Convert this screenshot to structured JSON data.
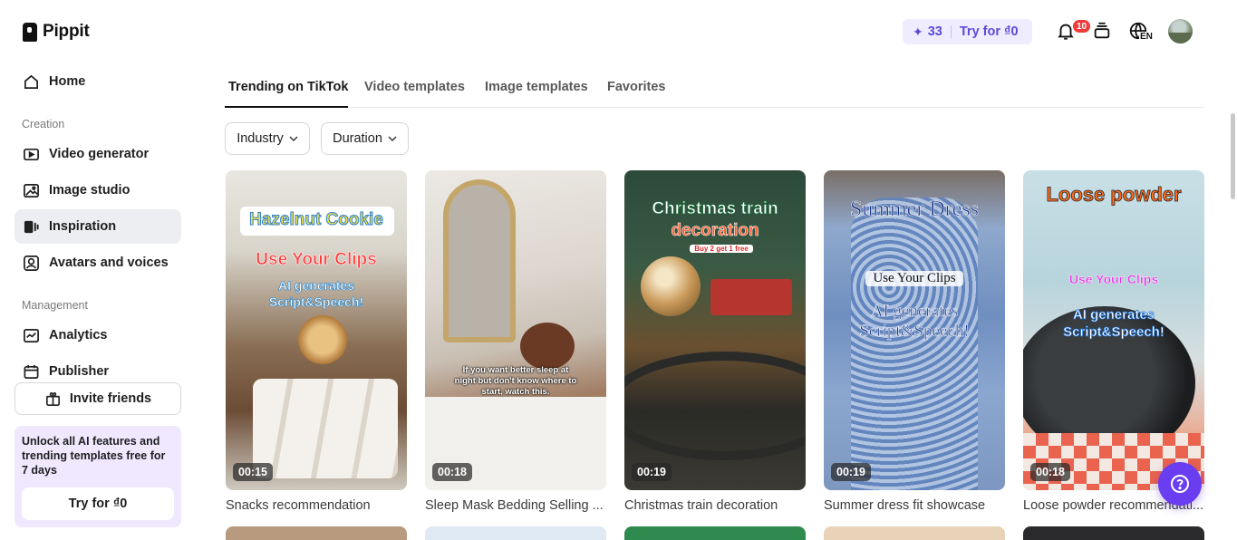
{
  "app": {
    "name": "Pippit"
  },
  "sidebar": {
    "home": "Home",
    "creation_label": "Creation",
    "creation_items": [
      "Video generator",
      "Image studio",
      "Inspiration",
      "Avatars and voices"
    ],
    "active_item": "Inspiration",
    "management_label": "Management",
    "management_items": [
      "Analytics",
      "Publisher"
    ],
    "invite_label": "Invite friends",
    "promo": {
      "text": "Unlock all AI features and trending templates free for 7 days",
      "button": "Try for ₫0"
    }
  },
  "header": {
    "credits": "33",
    "try_label": "Try for ₫0",
    "notification_count": "10",
    "language": "EN",
    "icons": [
      "sparkle-icon",
      "bell-icon",
      "stack-icon",
      "globe-icon"
    ]
  },
  "tabs": {
    "items": [
      "Trending on TikTok",
      "Video templates",
      "Image templates",
      "Favorites"
    ],
    "active": "Trending on TikTok"
  },
  "filters": {
    "industry": "Industry",
    "duration": "Duration"
  },
  "cards": [
    {
      "title": "Snacks recommendation",
      "duration": "00:15",
      "overlay": [
        "Hazelnut Cookie",
        "Use Your Clips",
        "AI generates Script&Speech!"
      ]
    },
    {
      "title": "Sleep Mask Bedding Selling ...",
      "duration": "00:18",
      "overlay": [
        "If you want better sleep at night but don't know where to start, watch this."
      ]
    },
    {
      "title": "Christmas train decoration",
      "duration": "00:19",
      "overlay": [
        "Christmas train",
        "decoration",
        "Buy 2 get 1 free"
      ]
    },
    {
      "title": "Summer dress fit showcase",
      "duration": "00:19",
      "overlay": [
        "Summer Dress",
        "Use Your Clips",
        "AI generates Script&Speech!"
      ]
    },
    {
      "title": "Loose powder recommendati...",
      "duration": "00:18",
      "overlay": [
        "Loose powder",
        "Use Your Clips",
        "AI generates Script&Speech!"
      ]
    }
  ],
  "colors": {
    "accent": "#6a3df0",
    "credits_bg": "#f0ecff",
    "badge": "#ee3b3b",
    "active_nav_bg": "#eceef1",
    "promo_bg": "#efe8ff"
  }
}
